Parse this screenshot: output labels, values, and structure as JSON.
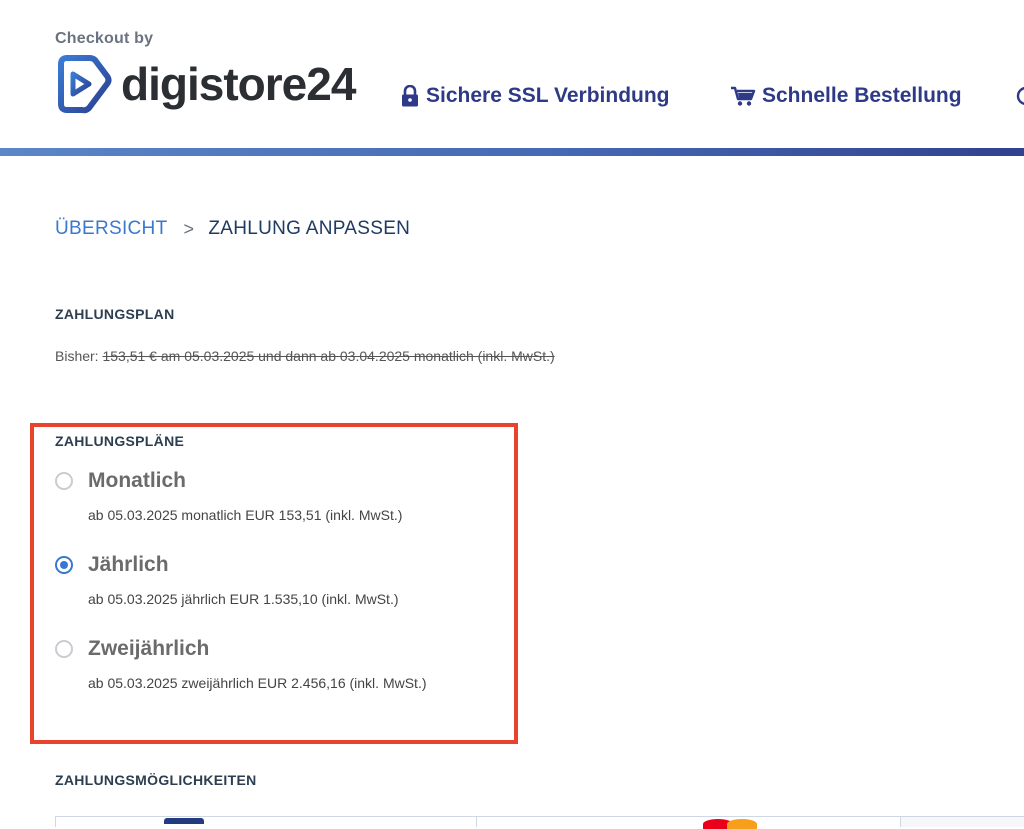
{
  "header": {
    "checkout_by": "Checkout by",
    "logo_text": "digistore24",
    "features": [
      {
        "label": "Sichere SSL Verbindung",
        "icon": "lock-icon"
      },
      {
        "label": "Schnelle Bestellung",
        "icon": "cart-icon"
      }
    ],
    "accent_color": "#2e3a87"
  },
  "breadcrumb": {
    "overview": "ÜBERSICHT",
    "separator": ">",
    "current": "ZAHLUNG ANPASSEN"
  },
  "payment_plan": {
    "title": "ZAHLUNGSPLAN",
    "previous_prefix": "Bisher:",
    "previous_value": "153,51 € am 05.03.2025 und dann ab 03.04.2025 monatlich (inkl. MwSt.)"
  },
  "plans": {
    "title": "ZAHLUNGSPLÄNE",
    "highlight_color": "#e8432d",
    "options": [
      {
        "label": "Monatlich",
        "description": "ab 05.03.2025 monatlich EUR 153,51 (inkl. MwSt.)",
        "selected": false
      },
      {
        "label": "Jährlich",
        "description": "ab 05.03.2025 jährlich EUR 1.535,10 (inkl. MwSt.)",
        "selected": true
      },
      {
        "label": "Zweijährlich",
        "description": "ab 05.03.2025 zweijährlich EUR 2.456,16 (inkl. MwSt.)",
        "selected": false
      }
    ]
  },
  "payment_options": {
    "title": "ZAHLUNGSMÖGLICHKEITEN"
  }
}
